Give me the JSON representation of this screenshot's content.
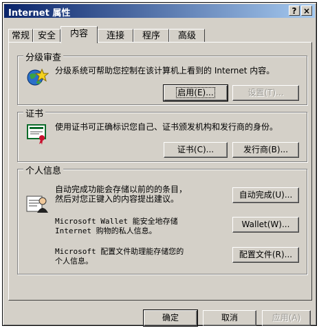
{
  "window": {
    "title": "Internet 属性",
    "help_button": "?",
    "close_button": "×"
  },
  "tabs": [
    {
      "label": "常规",
      "active": false
    },
    {
      "label": "安全",
      "active": false
    },
    {
      "label": "内容",
      "active": true
    },
    {
      "label": "连接",
      "active": false
    },
    {
      "label": "程序",
      "active": false
    },
    {
      "label": "高级",
      "active": false
    }
  ],
  "content_advisor": {
    "legend": "分级审查",
    "description": "分级系统可帮助您控制在该计算机上看到的 Internet 内容。",
    "enable_button": "启用(E)...",
    "settings_button": "设置(T)..."
  },
  "certificates": {
    "legend": "证书",
    "description": "使用证书可正确标识您自己、证书颁发机构和发行商的身份。",
    "certificates_button": "证书(C)...",
    "publishers_button": "发行商(B)..."
  },
  "personal_info": {
    "legend": "个人信息",
    "autocomplete_text_1": "自动完成功能会存储以前的的条目，",
    "autocomplete_text_2": "然后对您正键入的内容提出建议。",
    "autocomplete_button": "自动完成(U)...",
    "wallet_text_1": "Microsoft Wallet 能安全地存储",
    "wallet_text_2": "Internet 购物的私人信息。",
    "wallet_button": "Wallet(W)...",
    "profile_text_1": "Microsoft 配置文件助理能存储您的",
    "profile_text_2": "个人信息。",
    "profile_button": "配置文件(R)..."
  },
  "footer": {
    "ok_button": "确定",
    "cancel_button": "取消",
    "apply_button": "应用(A)"
  },
  "colors": {
    "titlebar_start": "#0a246a",
    "titlebar_end": "#a6caf0",
    "face": "#d4d0c8"
  }
}
